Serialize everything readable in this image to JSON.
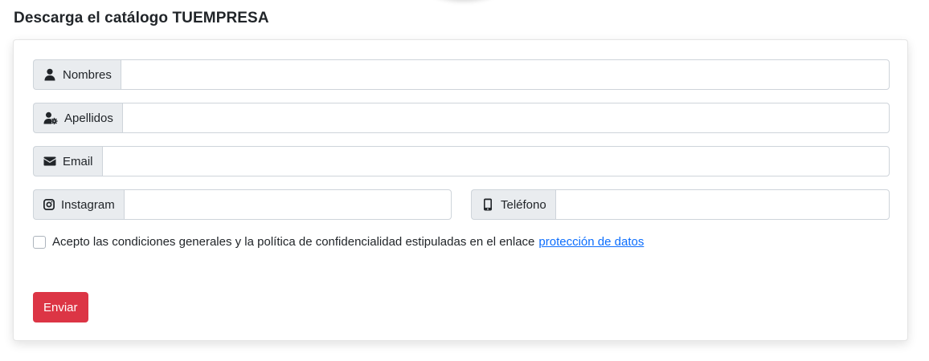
{
  "page": {
    "title": "Descarga el catálogo TUEMPRESA"
  },
  "form": {
    "fields": [
      {
        "label": "Nombres",
        "icon": "user-icon",
        "value": ""
      },
      {
        "label": "Apellidos",
        "icon": "user-gear-icon",
        "value": ""
      },
      {
        "label": "Email",
        "icon": "envelope-icon",
        "value": ""
      },
      {
        "label": "Instagram",
        "icon": "instagram-icon",
        "value": ""
      },
      {
        "label": "Teléfono",
        "icon": "mobile-phone-icon",
        "value": ""
      }
    ],
    "consent": {
      "text": "Acepto las condiciones generales y la política de confidencialidad estipuladas en el enlace",
      "link_text": "protección de datos",
      "checked": false
    },
    "submit_label": "Enviar"
  },
  "colors": {
    "submit_bg": "#dc3545",
    "link": "#0d6efd",
    "addon_bg": "#e9ecef",
    "border": "#ced4da"
  }
}
